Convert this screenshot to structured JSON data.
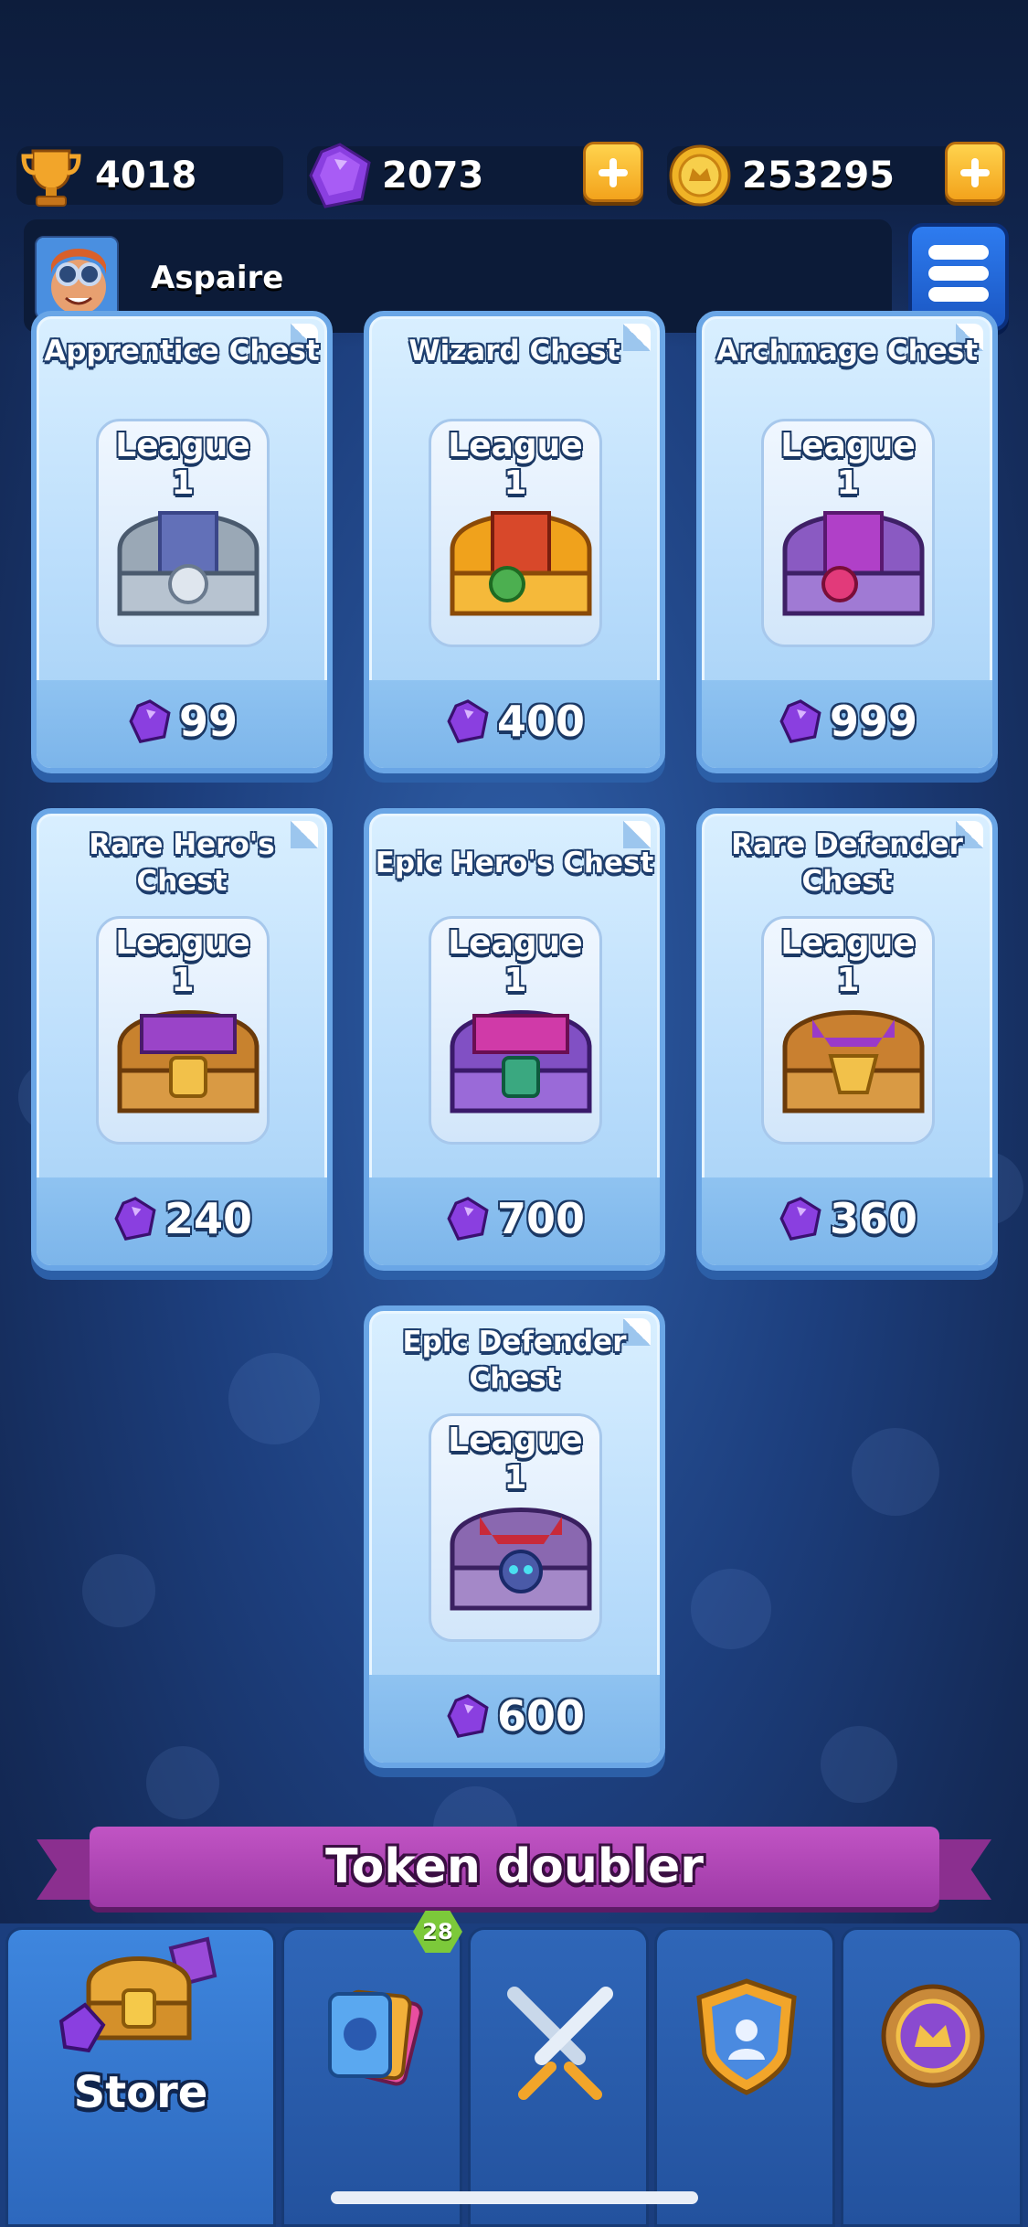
{
  "hud": {
    "trophies": "4018",
    "gems": "2073",
    "coins": "253295",
    "trophy_icon": "trophy-icon",
    "gem_icon": "gem-icon",
    "coin_icon": "coin-icon"
  },
  "player": {
    "name": "Aspaire",
    "menu_icon": "menu-icon"
  },
  "chests": [
    {
      "title": "Apprentice Chest",
      "league": "League 1",
      "price": "99",
      "color": "#9aa8b6"
    },
    {
      "title": "Wizard Chest",
      "league": "League 1",
      "price": "400",
      "color": "#f0a21c"
    },
    {
      "title": "Archmage Chest",
      "league": "League 1",
      "price": "999",
      "color": "#8a5ac2"
    },
    {
      "title_line1": "Rare Hero's",
      "title_line2": "Chest",
      "league": "League 1",
      "price": "240",
      "color": "#c8822e"
    },
    {
      "title": "Epic Hero's Chest",
      "league": "League 1",
      "price": "700",
      "color": "#8150c4"
    },
    {
      "title_line1": "Rare Defender",
      "title_line2": "Chest",
      "league": "League 1",
      "price": "360",
      "color": "#c98030"
    },
    {
      "title_line1": "Epic Defender",
      "title_line2": "Chest",
      "league": "League 1",
      "price": "600",
      "color": "#8a68b0"
    }
  ],
  "banner": {
    "label": "Token doubler"
  },
  "nav": {
    "store_label": "Store",
    "cards_badge": "28",
    "tabs": [
      "store",
      "cards",
      "battle",
      "clan",
      "league"
    ]
  },
  "colors": {
    "accent_gem": "#8a3fe0",
    "card_border": "#6aa6e6",
    "banner": "#b146b8",
    "plus_button": "#f6b52a"
  }
}
